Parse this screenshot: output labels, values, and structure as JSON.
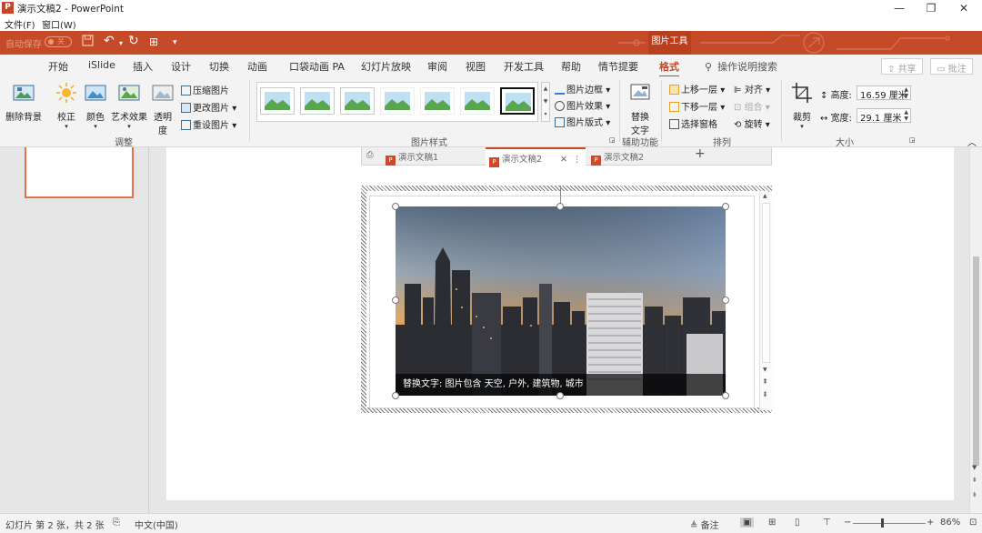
{
  "window": {
    "title": "演示文稿2 - PowerPoint",
    "app_icon": "P",
    "min": "—",
    "restore": "❐",
    "close": "✕"
  },
  "menubar": {
    "file": "文件(F)",
    "window": "窗口(W)"
  },
  "qat": {
    "autosave": "自动保存",
    "toggle": "关",
    "tool_context": "图片工具"
  },
  "tabs": [
    "开始",
    "iSlide",
    "插入",
    "设计",
    "切换",
    "动画",
    "口袋动画 PA",
    "幻灯片放映",
    "审阅",
    "视图",
    "开发工具",
    "帮助",
    "情节提要",
    "格式"
  ],
  "active_tab": "格式",
  "tell_me": "操作说明搜索",
  "share": "共享",
  "comments": "批注",
  "ribbon": {
    "remove_bg": "删除背景",
    "corrections": "校正",
    "color": "颜色",
    "artistic": "艺术效果",
    "transparency_line1": "透明",
    "transparency_line2": "度",
    "compress": "压缩图片",
    "change": "更改图片",
    "reset": "重设图片",
    "group_adjust": "调整",
    "group_styles": "图片样式",
    "border": "图片边框",
    "effects": "图片效果",
    "layout": "图片版式",
    "alt_text_line1": "替换",
    "alt_text_line2": "文字",
    "group_accessibility": "辅助功能",
    "bring_forward": "上移一层",
    "send_backward": "下移一层",
    "selection_pane": "选择窗格",
    "align": "对齐",
    "group": "组合",
    "rotate": "旋转",
    "group_arrange": "排列",
    "crop": "裁剪",
    "height_label": "高度:",
    "height_value": "16.59 厘米",
    "width_label": "宽度:",
    "width_value": "29.1 厘米",
    "group_size": "大小"
  },
  "embedded_tabs": [
    "演示文稿1",
    "演示文稿2",
    "演示文稿2"
  ],
  "image": {
    "alt_caption": "替换文字: 图片包含 天空, 户外, 建筑物, 城市"
  },
  "status": {
    "slide_info": "幻灯片 第 2 张，共 2 张",
    "language": "中文(中国)",
    "notes": "备注",
    "zoom": "86%"
  },
  "colors": {
    "accent": "#c54a28",
    "ribbon_bg": "#f3f3f3"
  }
}
